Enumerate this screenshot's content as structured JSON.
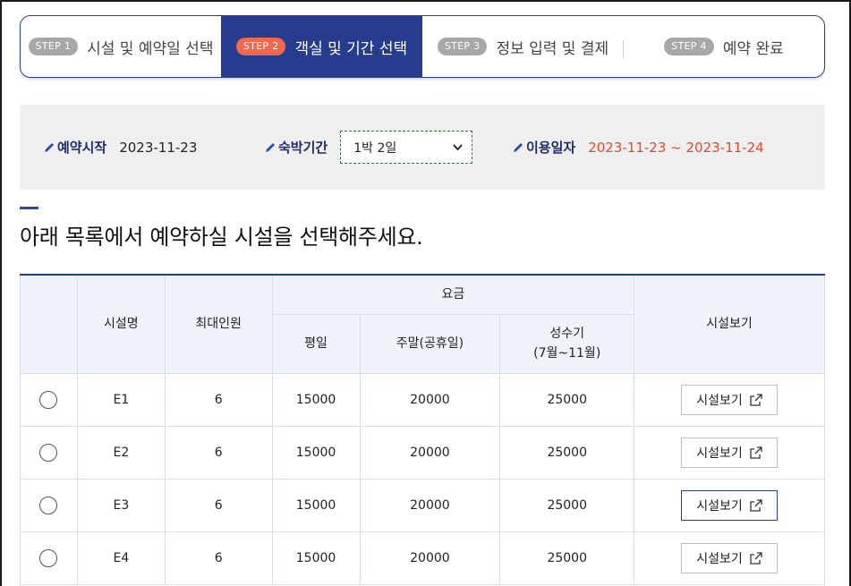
{
  "steps": [
    {
      "badge": "STEP 1",
      "label": "시설 및 예약일 선택",
      "active": false
    },
    {
      "badge": "STEP 2",
      "label": "객실 및 기간 선택",
      "active": true
    },
    {
      "badge": "STEP 3",
      "label": "정보 입력 및 결제",
      "active": false
    },
    {
      "badge": "STEP 4",
      "label": "예약 완료",
      "active": false
    }
  ],
  "info": {
    "start_label": "예약시작",
    "start_value": "2023-11-23",
    "stay_label": "숙박기간",
    "stay_value": "1박 2일",
    "use_label": "이용일자",
    "use_value": "2023-11-23 ~ 2023-11-24"
  },
  "heading": "아래 목록에서 예약하실 시설을 선택해주세요.",
  "table": {
    "headers": {
      "name": "시설명",
      "max": "최대인원",
      "fee": "요금",
      "weekday": "평일",
      "weekend": "주말(공휴일)",
      "peak_line1": "성수기",
      "peak_line2": "(7월~11월)",
      "view": "시설보기"
    },
    "rows": [
      {
        "name": "E1",
        "max": "6",
        "weekday": "15000",
        "weekend": "20000",
        "peak": "25000",
        "btn": "시설보기"
      },
      {
        "name": "E2",
        "max": "6",
        "weekday": "15000",
        "weekend": "20000",
        "peak": "25000",
        "btn": "시설보기"
      },
      {
        "name": "E3",
        "max": "6",
        "weekday": "15000",
        "weekend": "20000",
        "peak": "25000",
        "btn": "시설보기"
      },
      {
        "name": "E4",
        "max": "6",
        "weekday": "15000",
        "weekend": "20000",
        "peak": "25000",
        "btn": "시설보기"
      }
    ]
  },
  "colors": {
    "primary": "#253c8f",
    "accent": "#f0694e",
    "date_red": "#e24a2a"
  }
}
